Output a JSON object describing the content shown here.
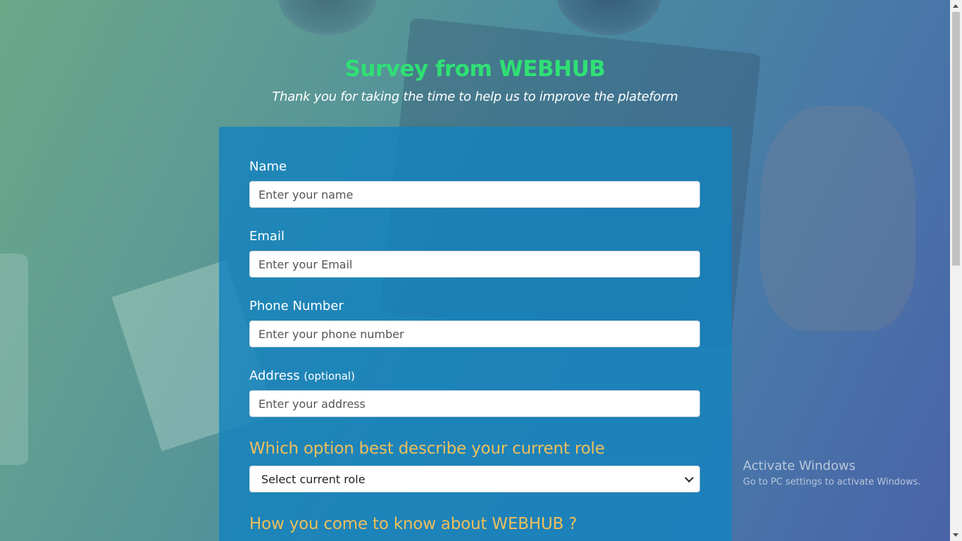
{
  "header": {
    "title": "Survey from WEBHUB",
    "subtitle": "Thank you for taking the time to help us to improve the plateform"
  },
  "form": {
    "name": {
      "label": "Name",
      "placeholder": "Enter your name"
    },
    "email": {
      "label": "Email",
      "placeholder": "Enter your Email"
    },
    "phone": {
      "label": "Phone Number",
      "placeholder": "Enter your phone number"
    },
    "address": {
      "label": "Address",
      "optional": "(optional)",
      "placeholder": "Enter your address"
    },
    "role_question": "Which option best describe your current role",
    "role_select": {
      "selected": "Select current role"
    },
    "source_question": "How you come to know about WEBHUB ?"
  },
  "watermark": {
    "title": "Activate Windows",
    "subtitle": "Go to PC settings to activate Windows."
  },
  "colors": {
    "title": "#2fe074",
    "question": "#efbf5a",
    "card": "#1482be"
  }
}
